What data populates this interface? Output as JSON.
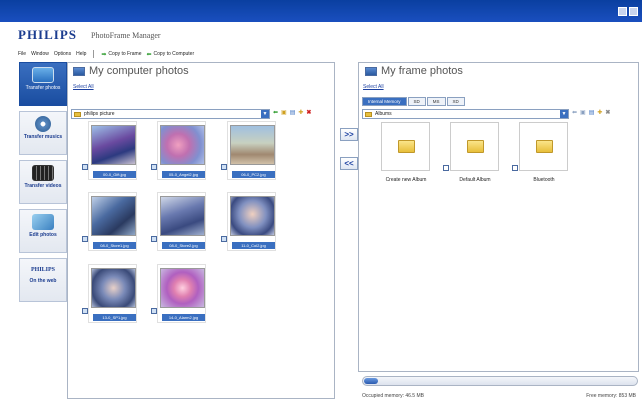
{
  "brand": {
    "logo": "PHILIPS",
    "app_name": "PhotoFrame Manager"
  },
  "menu": [
    "File",
    "Window",
    "Options",
    "Help"
  ],
  "actions": {
    "copy_to_frame": "Copy to Frame",
    "copy_to_computer": "Copy to Computer"
  },
  "sidebar": {
    "items": [
      {
        "label": "Transfer photos"
      },
      {
        "label": "Transfer musics"
      },
      {
        "label": "Transfer videos"
      },
      {
        "label": "Edit photos"
      },
      {
        "label": "On the web",
        "logo": "PHILIPS"
      }
    ]
  },
  "computer": {
    "title": "My computer photos",
    "select_all": "Select All",
    "path": "philips picture",
    "photos": [
      {
        "caption": "00-0_Gift.jpg"
      },
      {
        "caption": "05-0_Angel2.jpg"
      },
      {
        "caption": "06-0_PC2.jpg"
      },
      {
        "caption": "08-0_Store1.jpg"
      },
      {
        "caption": "08-0_Store2.jpg"
      },
      {
        "caption": "11-0_Col2.jpg"
      },
      {
        "caption": "13-0_SP1.jpg"
      },
      {
        "caption": "14-0_Alarm2.jpg"
      }
    ]
  },
  "transfer": {
    "to_frame": ">>",
    "to_computer": "<<"
  },
  "frame": {
    "title": "My frame photos",
    "select_all": "Select All",
    "tabs": [
      "Internal Memory",
      "SD",
      "MS",
      "XD"
    ],
    "path": "Albums",
    "albums": [
      {
        "label": "Create new Album"
      },
      {
        "label": "Default Album"
      },
      {
        "label": "Bluetooth"
      }
    ]
  },
  "memory": {
    "occupied": "Occupied memory: 46.5 MB",
    "free": "Free memory: 853 MB",
    "used_fraction": 0.05
  },
  "colors": {
    "brand_blue": "#1b3c8f",
    "accent": "#3a6fc0"
  }
}
